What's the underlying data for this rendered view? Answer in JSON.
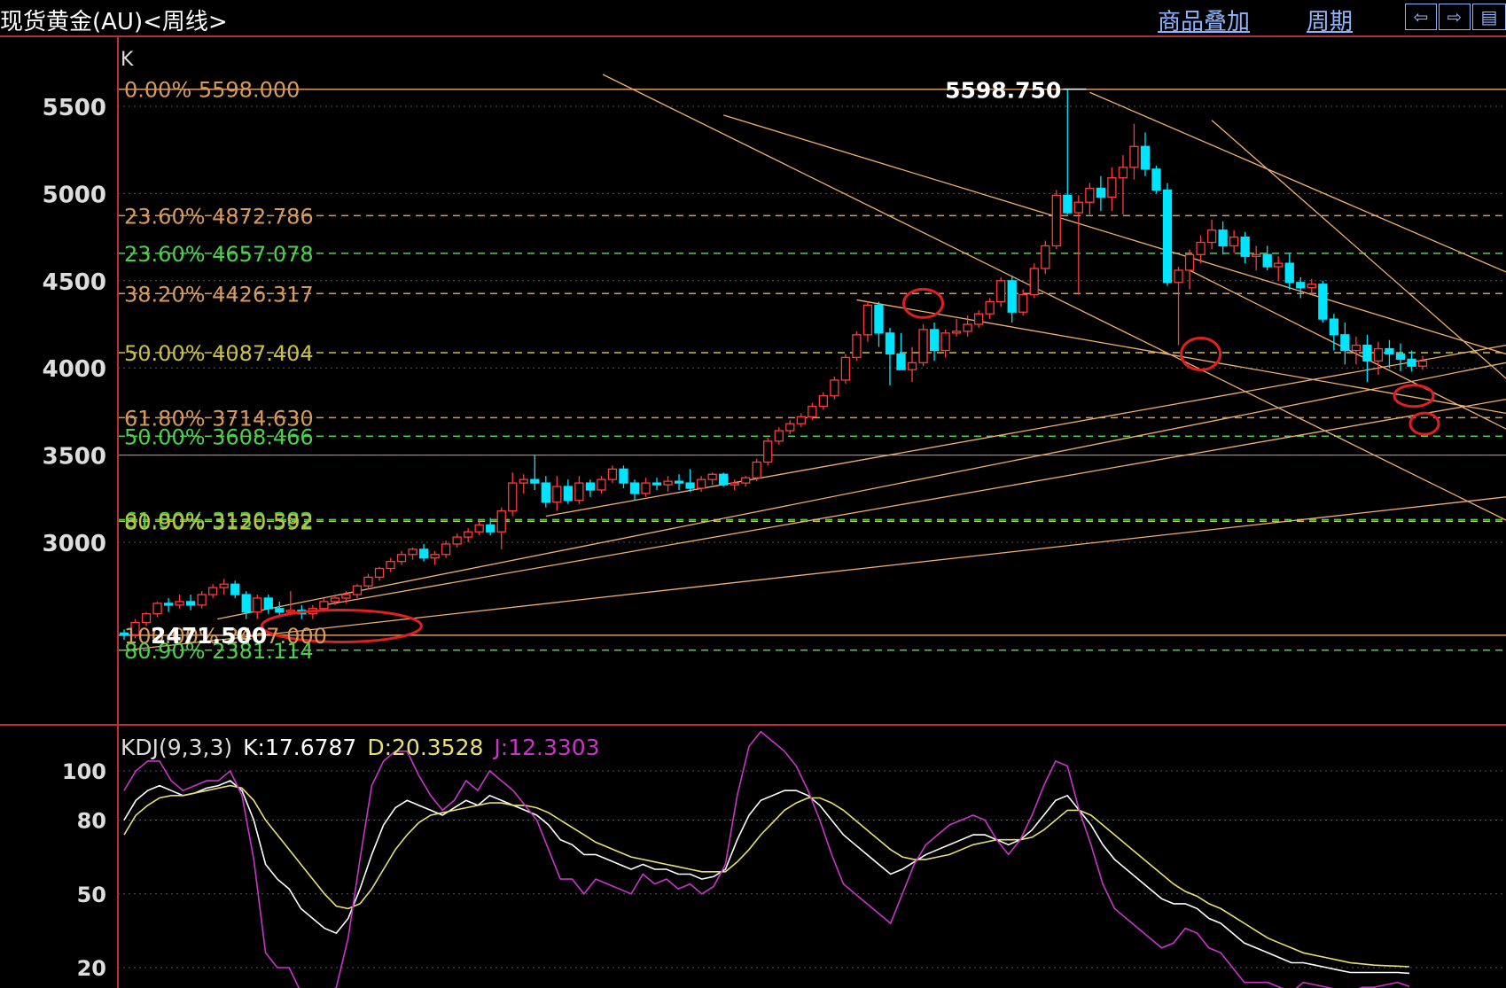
{
  "window": {
    "title": "现货黄金(AU)<周线>",
    "overlay_label": "商品叠加",
    "period_label": "周期",
    "nav_left": "⇦",
    "nav_right": "⇨",
    "nav_more": "▤"
  },
  "colors": {
    "background": "#000000",
    "up": "#ff3b3b",
    "down": "#00e5ff",
    "fib_orange": "#d89a5c",
    "fib_green": "#4cd04c",
    "fib_yellow": "#c8c040",
    "trendline": "#f0b070",
    "kdj_k": "#ffffff",
    "kdj_d": "#e8e070",
    "kdj_j": "#cc33cc",
    "axis": "#c03030"
  },
  "chart_data": [
    {
      "type": "candlestick",
      "panel_label": "K",
      "y_ticks": [
        3000,
        3500,
        4000,
        4500,
        5000,
        5500
      ],
      "ylim": [
        2340,
        5650
      ],
      "high_label": "5598.750",
      "low_label": "2471.500",
      "fib_levels": [
        {
          "pct": "0.00%",
          "value": 5598.0,
          "label": "0.00% 5598.000",
          "color": "orange"
        },
        {
          "pct": "23.60%",
          "value": 4872.786,
          "label": "23.60% 4872.786",
          "color": "orange"
        },
        {
          "pct": "23.60%",
          "value": 4657.078,
          "label": "23.60% 4657.078",
          "color": "green"
        },
        {
          "pct": "38.20%",
          "value": 4426.317,
          "label": "38.20% 4426.317",
          "color": "orange"
        },
        {
          "pct": "50.00%",
          "value": 4087.404,
          "label": "50.00% 4087.404",
          "color": "yellow"
        },
        {
          "pct": "61.80%",
          "value": 3714.63,
          "label": "61.80% 3714.630",
          "color": "orange"
        },
        {
          "pct": "50.00%",
          "value": 3608.466,
          "label": "50.00% 3608.466",
          "color": "green"
        },
        {
          "pct": "61.80%",
          "value": 3130.382,
          "label": "61.80% 3130.382",
          "color": "green"
        },
        {
          "pct": "80.90%",
          "value": 3120.592,
          "label": "80.90% 3120.592",
          "color": "yellow"
        },
        {
          "pct": "100.00%",
          "value": 2467.0,
          "label": "100.00% 2467.000",
          "color": "orange"
        },
        {
          "pct": "80.90%",
          "value": 2381.114,
          "label": "80.90% 2381.114",
          "color": "green"
        }
      ],
      "candles": [
        [
          2480,
          2500,
          2440,
          2470
        ],
        [
          2470,
          2560,
          2450,
          2540
        ],
        [
          2540,
          2600,
          2520,
          2590
        ],
        [
          2590,
          2660,
          2570,
          2650
        ],
        [
          2650,
          2680,
          2600,
          2640
        ],
        [
          2640,
          2700,
          2620,
          2660
        ],
        [
          2660,
          2700,
          2610,
          2640
        ],
        [
          2640,
          2720,
          2620,
          2700
        ],
        [
          2700,
          2760,
          2680,
          2740
        ],
        [
          2740,
          2790,
          2700,
          2760
        ],
        [
          2760,
          2780,
          2680,
          2700
        ],
        [
          2700,
          2720,
          2560,
          2600
        ],
        [
          2600,
          2700,
          2560,
          2680
        ],
        [
          2680,
          2700,
          2590,
          2620
        ],
        [
          2620,
          2660,
          2580,
          2600
        ],
        [
          2600,
          2720,
          2580,
          2610
        ],
        [
          2610,
          2640,
          2560,
          2590
        ],
        [
          2590,
          2640,
          2560,
          2620
        ],
        [
          2620,
          2680,
          2600,
          2660
        ],
        [
          2660,
          2700,
          2640,
          2680
        ],
        [
          2680,
          2720,
          2650,
          2700
        ],
        [
          2700,
          2760,
          2680,
          2750
        ],
        [
          2750,
          2820,
          2730,
          2800
        ],
        [
          2800,
          2860,
          2780,
          2850
        ],
        [
          2850,
          2910,
          2830,
          2890
        ],
        [
          2890,
          2950,
          2870,
          2930
        ],
        [
          2930,
          2970,
          2900,
          2960
        ],
        [
          2960,
          2990,
          2890,
          2910
        ],
        [
          2910,
          2950,
          2870,
          2930
        ],
        [
          2930,
          3010,
          2910,
          2990
        ],
        [
          2990,
          3050,
          2970,
          3030
        ],
        [
          3030,
          3080,
          3000,
          3060
        ],
        [
          3060,
          3120,
          3040,
          3100
        ],
        [
          3100,
          3140,
          3040,
          3060
        ],
        [
          3060,
          3200,
          2960,
          3180
        ],
        [
          3180,
          3400,
          3150,
          3340
        ],
        [
          3340,
          3390,
          3280,
          3360
        ],
        [
          3360,
          3500,
          3300,
          3340
        ],
        [
          3340,
          3380,
          3200,
          3230
        ],
        [
          3230,
          3380,
          3180,
          3320
        ],
        [
          3320,
          3360,
          3220,
          3240
        ],
        [
          3240,
          3380,
          3220,
          3340
        ],
        [
          3340,
          3360,
          3260,
          3300
        ],
        [
          3300,
          3380,
          3280,
          3360
        ],
        [
          3360,
          3440,
          3340,
          3420
        ],
        [
          3420,
          3440,
          3310,
          3340
        ],
        [
          3340,
          3360,
          3240,
          3280
        ],
        [
          3280,
          3370,
          3260,
          3340
        ],
        [
          3340,
          3370,
          3300,
          3330
        ],
        [
          3330,
          3380,
          3290,
          3350
        ],
        [
          3350,
          3390,
          3300,
          3340
        ],
        [
          3340,
          3420,
          3290,
          3310
        ],
        [
          3310,
          3380,
          3290,
          3360
        ],
        [
          3360,
          3400,
          3330,
          3390
        ],
        [
          3390,
          3400,
          3320,
          3330
        ],
        [
          3330,
          3360,
          3300,
          3340
        ],
        [
          3340,
          3380,
          3320,
          3370
        ],
        [
          3370,
          3480,
          3350,
          3460
        ],
        [
          3460,
          3600,
          3440,
          3580
        ],
        [
          3580,
          3660,
          3560,
          3640
        ],
        [
          3640,
          3700,
          3620,
          3680
        ],
        [
          3680,
          3740,
          3660,
          3720
        ],
        [
          3720,
          3800,
          3700,
          3780
        ],
        [
          3780,
          3860,
          3760,
          3840
        ],
        [
          3840,
          3950,
          3820,
          3930
        ],
        [
          3930,
          4080,
          3910,
          4060
        ],
        [
          4060,
          4210,
          4040,
          4190
        ],
        [
          4190,
          4380,
          4150,
          4360
        ],
        [
          4360,
          4380,
          4120,
          4200
        ],
        [
          4200,
          4230,
          3900,
          4080
        ],
        [
          4080,
          4200,
          4040,
          3990
        ],
        [
          3990,
          4120,
          3920,
          4030
        ],
        [
          4030,
          4250,
          4010,
          4220
        ],
        [
          4220,
          4260,
          4040,
          4100
        ],
        [
          4100,
          4220,
          4060,
          4200
        ],
        [
          4200,
          4280,
          4180,
          4210
        ],
        [
          4210,
          4300,
          4180,
          4250
        ],
        [
          4250,
          4330,
          4230,
          4310
        ],
        [
          4310,
          4400,
          4280,
          4380
        ],
        [
          4380,
          4520,
          4350,
          4500
        ],
        [
          4500,
          4530,
          4260,
          4320
        ],
        [
          4320,
          4450,
          4300,
          4420
        ],
        [
          4420,
          4600,
          4400,
          4570
        ],
        [
          4570,
          4730,
          4540,
          4700
        ],
        [
          4700,
          5020,
          4680,
          4990
        ],
        [
          4990,
          5598.75,
          4880,
          4890
        ],
        [
          4890,
          4990,
          4420,
          4950
        ],
        [
          4950,
          5060,
          4880,
          5030
        ],
        [
          5030,
          5100,
          4900,
          4980
        ],
        [
          4980,
          5150,
          4900,
          5090
        ],
        [
          5090,
          5220,
          4880,
          5150
        ],
        [
          5150,
          5400,
          5080,
          5270
        ],
        [
          5270,
          5350,
          5100,
          5140
        ],
        [
          5140,
          5160,
          5000,
          5020
        ],
        [
          5020,
          5060,
          4470,
          4490
        ],
        [
          4490,
          4580,
          4130,
          4560
        ],
        [
          4560,
          4680,
          4450,
          4650
        ],
        [
          4650,
          4760,
          4600,
          4720
        ],
        [
          4720,
          4850,
          4680,
          4790
        ],
        [
          4790,
          4840,
          4650,
          4700
        ],
        [
          4700,
          4790,
          4660,
          4750
        ],
        [
          4750,
          4780,
          4600,
          4640
        ],
        [
          4640,
          4700,
          4560,
          4650
        ],
        [
          4650,
          4700,
          4560,
          4580
        ],
        [
          4580,
          4640,
          4500,
          4600
        ],
        [
          4600,
          4660,
          4450,
          4490
        ],
        [
          4490,
          4520,
          4400,
          4460
        ],
        [
          4460,
          4510,
          4420,
          4480
        ],
        [
          4480,
          4500,
          4260,
          4280
        ],
        [
          4280,
          4310,
          4100,
          4190
        ],
        [
          4190,
          4260,
          4020,
          4100
        ],
        [
          4100,
          4180,
          4020,
          4130
        ],
        [
          4130,
          4190,
          3920,
          4040
        ],
        [
          4040,
          4150,
          3960,
          4110
        ],
        [
          4110,
          4160,
          4000,
          4080
        ],
        [
          4080,
          4140,
          3980,
          4050
        ],
        [
          4050,
          4100,
          3980,
          4010
        ],
        [
          4010,
          4070,
          3990,
          4040
        ]
      ]
    },
    {
      "type": "line",
      "panel_label": "KDJ(9,3,3)",
      "k_label": "K:17.6787",
      "d_label": "D:20.3528",
      "j_label": "J:12.3303",
      "y_ticks": [
        20,
        50,
        80,
        100
      ],
      "ylim": [
        0,
        110
      ],
      "series": [
        {
          "name": "K",
          "values": [
            80,
            88,
            92,
            94,
            92,
            90,
            91,
            93,
            94,
            96,
            92,
            80,
            62,
            56,
            52,
            44,
            40,
            36,
            34,
            40,
            52,
            66,
            78,
            85,
            88,
            86,
            84,
            82,
            85,
            88,
            86,
            90,
            88,
            86,
            84,
            82,
            78,
            72,
            70,
            66,
            66,
            64,
            62,
            60,
            62,
            60,
            60,
            58,
            58,
            56,
            57,
            60,
            72,
            82,
            88,
            90,
            92,
            92,
            90,
            86,
            80,
            74,
            70,
            66,
            62,
            58,
            60,
            63,
            66,
            68,
            70,
            72,
            74,
            74,
            72,
            70,
            72,
            76,
            82,
            88,
            90,
            84,
            78,
            70,
            64,
            60,
            56,
            52,
            48,
            46,
            46,
            44,
            40,
            38,
            34,
            30,
            28,
            26,
            24,
            22,
            22,
            21,
            20,
            19,
            18,
            18,
            18,
            18,
            18,
            17.68
          ]
        },
        {
          "name": "D",
          "values": [
            74,
            82,
            86,
            89,
            90,
            90,
            91,
            92,
            93,
            94,
            93,
            88,
            80,
            74,
            68,
            62,
            56,
            50,
            45,
            44,
            46,
            52,
            60,
            68,
            74,
            79,
            82,
            83,
            84,
            85,
            86,
            87,
            87,
            86,
            86,
            85,
            83,
            80,
            77,
            74,
            71,
            69,
            67,
            65,
            64,
            63,
            62,
            61,
            60,
            59,
            59,
            59,
            63,
            68,
            74,
            79,
            84,
            87,
            89,
            89,
            87,
            84,
            80,
            76,
            72,
            68,
            65,
            64,
            64,
            65,
            66,
            68,
            70,
            71,
            72,
            72,
            72,
            73,
            76,
            80,
            84,
            84,
            82,
            78,
            74,
            70,
            66,
            62,
            58,
            54,
            51,
            49,
            46,
            44,
            41,
            38,
            35,
            32,
            30,
            28,
            26,
            25,
            24,
            23,
            22,
            21.5,
            21,
            20.8,
            20.6,
            20.35
          ]
        },
        {
          "name": "J",
          "values": [
            92,
            100,
            104,
            104,
            96,
            92,
            94,
            96,
            96,
            100,
            90,
            64,
            26,
            20,
            20,
            10,
            8,
            8,
            12,
            32,
            64,
            94,
            104,
            108,
            108,
            98,
            90,
            84,
            88,
            96,
            92,
            100,
            96,
            92,
            86,
            80,
            68,
            56,
            56,
            50,
            56,
            54,
            52,
            50,
            58,
            54,
            56,
            52,
            54,
            50,
            53,
            62,
            90,
            110,
            116,
            112,
            108,
            102,
            92,
            80,
            66,
            54,
            50,
            46,
            42,
            38,
            50,
            62,
            70,
            74,
            78,
            80,
            82,
            80,
            72,
            66,
            72,
            82,
            94,
            104,
            102,
            84,
            70,
            54,
            44,
            40,
            36,
            32,
            28,
            30,
            36,
            34,
            28,
            26,
            20,
            14,
            14,
            14,
            12,
            10,
            14,
            13,
            12,
            11,
            10,
            12,
            12,
            13,
            14,
            12.33
          ]
        }
      ]
    }
  ]
}
